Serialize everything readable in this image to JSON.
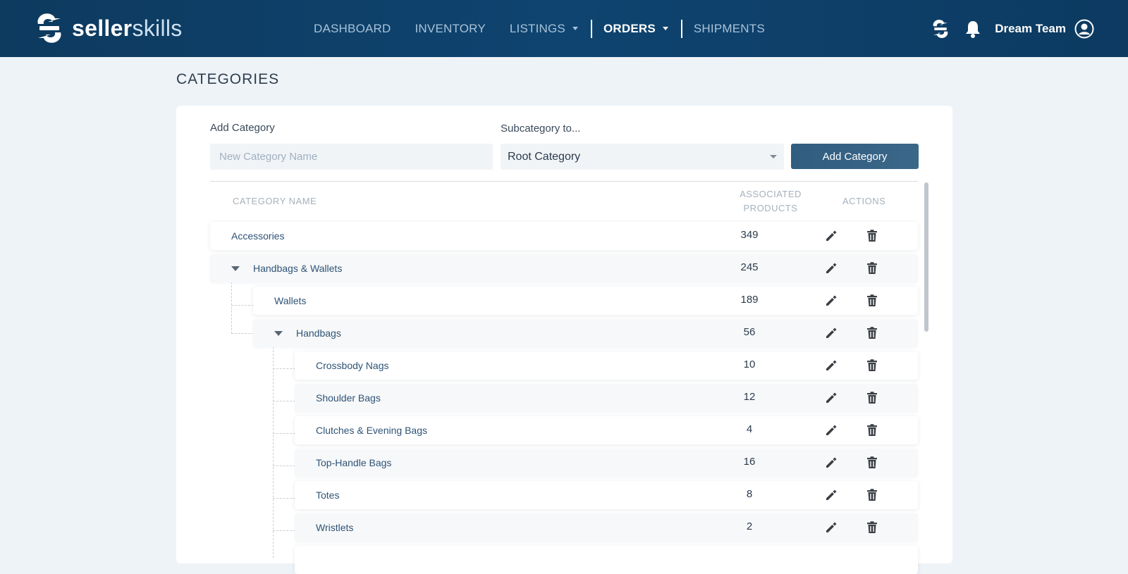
{
  "brand": {
    "bold": "seller",
    "light": "skills"
  },
  "nav": {
    "items": [
      {
        "label": "DASHBOARD"
      },
      {
        "label": "INVENTORY"
      },
      {
        "label": "LISTINGS"
      },
      {
        "label": "ORDERS"
      },
      {
        "label": "SHIPMENTS"
      }
    ],
    "user_name": "Dream Team"
  },
  "page": {
    "title": "CATEGORIES"
  },
  "form": {
    "add_label": "Add Category",
    "name_placeholder": "New Category Name",
    "name_value": "",
    "parent_label": "Subcategory to...",
    "parent_value": "Root Category",
    "submit_label": "Add Category"
  },
  "table": {
    "headers": {
      "name": "CATEGORY NAME",
      "products_line1": "ASSOCIATED",
      "products_line2": "PRODUCTS",
      "actions": "ACTIONS"
    },
    "rows": [
      {
        "name": "Accessories",
        "count": "349",
        "expanded": false,
        "level": 0
      },
      {
        "name": "Handbags & Wallets",
        "count": "245",
        "expanded": true,
        "level": 0
      },
      {
        "name": "Wallets",
        "count": "189",
        "expanded": false,
        "level": 1
      },
      {
        "name": "Handbags",
        "count": "56",
        "expanded": true,
        "level": 1
      },
      {
        "name": "Crossbody Nags",
        "count": "10",
        "expanded": false,
        "level": 2
      },
      {
        "name": "Shoulder Bags",
        "count": "12",
        "expanded": false,
        "level": 2
      },
      {
        "name": "Clutches & Evening Bags",
        "count": "4",
        "expanded": false,
        "level": 2
      },
      {
        "name": "Top-Handle Bags",
        "count": "16",
        "expanded": false,
        "level": 2
      },
      {
        "name": "Totes",
        "count": "8",
        "expanded": false,
        "level": 2
      },
      {
        "name": "Wristlets",
        "count": "2",
        "expanded": false,
        "level": 2
      }
    ]
  },
  "colors": {
    "navbar": "#0f4470",
    "accent_button": "#305d80",
    "link_text": "#2e5376",
    "page_bg": "#eef3f7"
  },
  "icons": {
    "logo": "sync-s-logo-icon",
    "sync": "sync-icon",
    "bell": "bell-icon",
    "user": "user-circle-icon",
    "edit": "pencil-icon",
    "delete": "trash-icon",
    "expand": "caret-down-icon"
  }
}
